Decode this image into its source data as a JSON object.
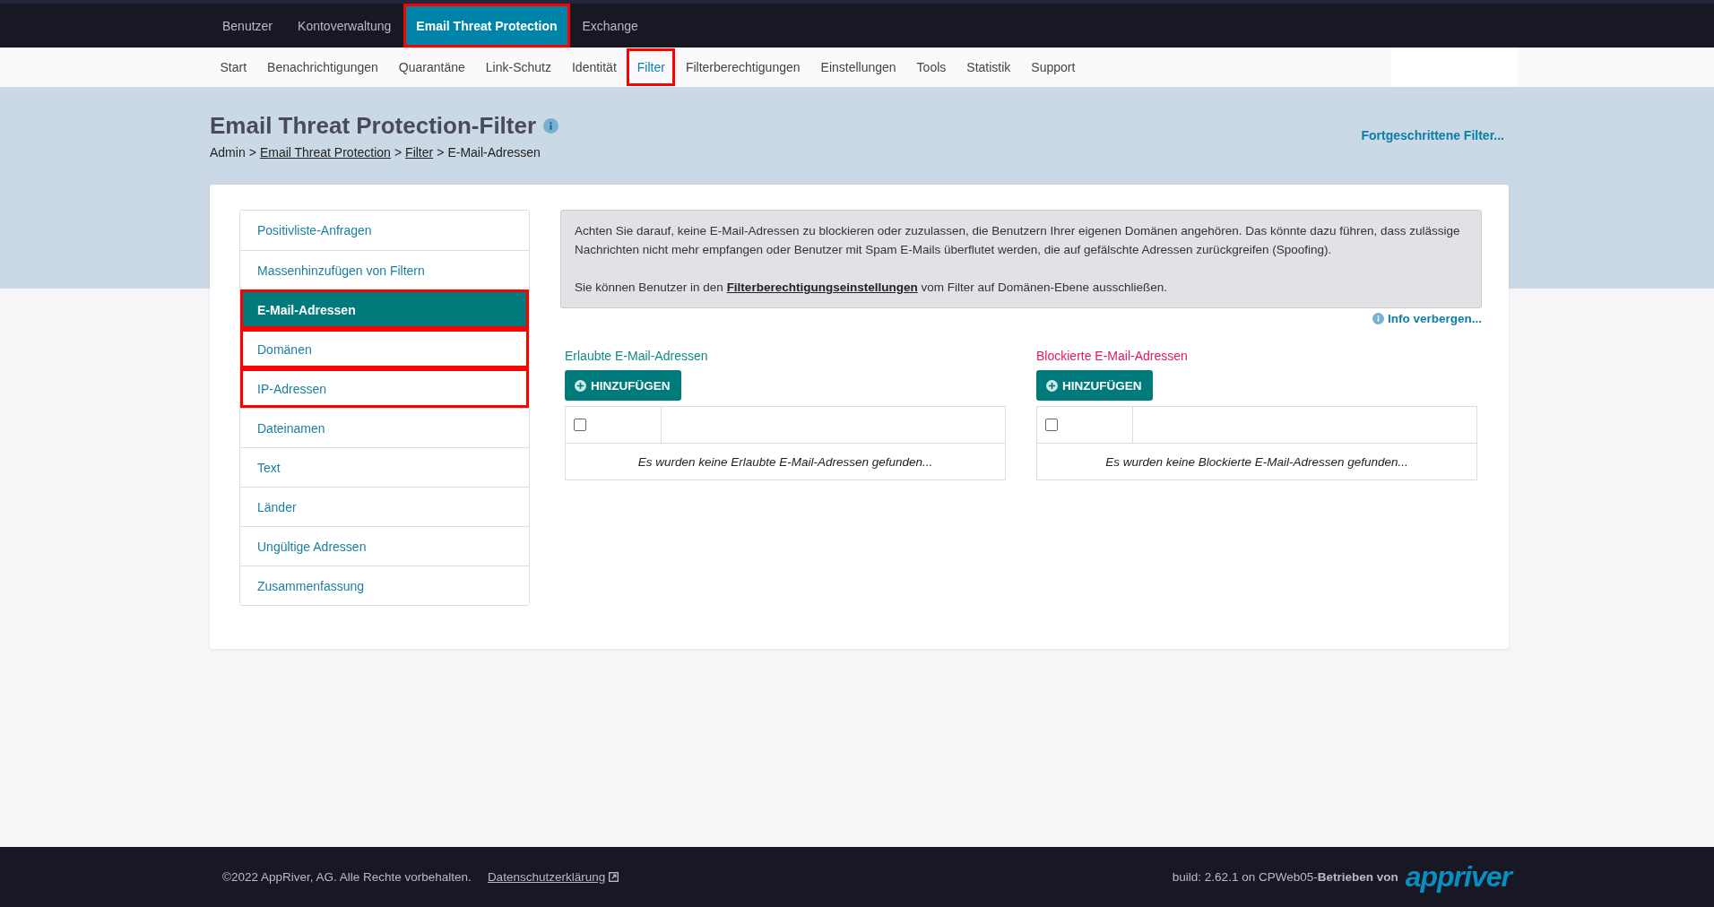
{
  "top_nav": [
    {
      "label": "Benutzer",
      "selected": false,
      "highlighted": false
    },
    {
      "label": "Kontoverwaltung",
      "selected": false,
      "highlighted": false
    },
    {
      "label": "Email Threat Protection",
      "selected": true,
      "highlighted": true
    },
    {
      "label": "Exchange",
      "selected": false,
      "highlighted": false
    }
  ],
  "sub_nav": [
    {
      "label": "Start",
      "selected": false,
      "highlighted": false
    },
    {
      "label": "Benachrichtigungen",
      "selected": false,
      "highlighted": false
    },
    {
      "label": "Quarantäne",
      "selected": false,
      "highlighted": false
    },
    {
      "label": "Link-Schutz",
      "selected": false,
      "highlighted": false
    },
    {
      "label": "Identität",
      "selected": false,
      "highlighted": false
    },
    {
      "label": "Filter",
      "selected": true,
      "highlighted": true
    },
    {
      "label": "Filterberechtigungen",
      "selected": false,
      "highlighted": false
    },
    {
      "label": "Einstellungen",
      "selected": false,
      "highlighted": false
    },
    {
      "label": "Tools",
      "selected": false,
      "highlighted": false
    },
    {
      "label": "Statistik",
      "selected": false,
      "highlighted": false
    },
    {
      "label": "Support",
      "selected": false,
      "highlighted": false
    }
  ],
  "page": {
    "title": "Email Threat Protection-Filter",
    "breadcrumb": [
      {
        "kind": "crumb",
        "label": "Admin",
        "link": false
      },
      {
        "kind": "separator",
        "label": ">"
      },
      {
        "kind": "crumb",
        "label": "Email Threat Protection",
        "link": true
      },
      {
        "kind": "separator",
        "label": ">"
      },
      {
        "kind": "crumb",
        "label": "Filter",
        "link": true
      },
      {
        "kind": "separator",
        "label": ">"
      },
      {
        "kind": "crumb",
        "label": "E-Mail-Adressen",
        "link": false
      }
    ],
    "advanced_link": "Fortgeschrittene Filter..."
  },
  "sidebar": {
    "items": [
      {
        "label": "Positivliste-Anfragen",
        "selected": false,
        "highlighted": false
      },
      {
        "label": "Massenhinzufügen von Filtern",
        "selected": false,
        "highlighted": false
      },
      {
        "label": "E-Mail-Adressen",
        "selected": true,
        "highlighted": true
      },
      {
        "label": "Domänen",
        "selected": false,
        "highlighted": true
      },
      {
        "label": "IP-Adressen",
        "selected": false,
        "highlighted": true
      },
      {
        "label": "Dateinamen",
        "selected": false,
        "highlighted": false
      },
      {
        "label": "Text",
        "selected": false,
        "highlighted": false
      },
      {
        "label": "Länder",
        "selected": false,
        "highlighted": false
      },
      {
        "label": "Ungültige Adressen",
        "selected": false,
        "highlighted": false
      },
      {
        "label": "Zusammenfassung",
        "selected": false,
        "highlighted": false
      }
    ]
  },
  "info": {
    "paragraph_1": "Achten Sie darauf, keine E-Mail-Adressen zu blockieren oder zuzulassen, die Benutzern Ihrer eigenen Domänen angehören. Das könnte dazu führen, dass zulässige Nachrichten nicht mehr empfangen oder Benutzer mit Spam E-Mails überflutet werden, die auf gefälschte Adressen zurückgreifen (Spoofing).",
    "paragraph_2_before": "Sie können Benutzer in den ",
    "paragraph_2_link": "Filterberechtigungseinstellungen",
    "paragraph_2_after": " vom Filter auf Domänen-Ebene ausschließen.",
    "hide_link": "Info verbergen..."
  },
  "lists": [
    {
      "kind": "allowed",
      "title": "Erlaubte E-Mail-Adressen",
      "add_button": "HINZUFÜGEN",
      "select_all_checked": false,
      "empty_text": "Es wurden keine Erlaubte E-Mail-Adressen gefunden..."
    },
    {
      "kind": "blocked",
      "title": "Blockierte E-Mail-Adressen",
      "add_button": "HINZUFÜGEN",
      "select_all_checked": false,
      "empty_text": "Es wurden keine Blockierte E-Mail-Adressen gefunden..."
    }
  ],
  "footer": {
    "copyright": "©2022 AppRiver, AG. Alle Rechte vorbehalten.",
    "privacy_link": "Datenschutzerklärung",
    "build": "build: 2.62.1 on CPWeb05-**Betrieben von**",
    "logo": "appriver"
  }
}
